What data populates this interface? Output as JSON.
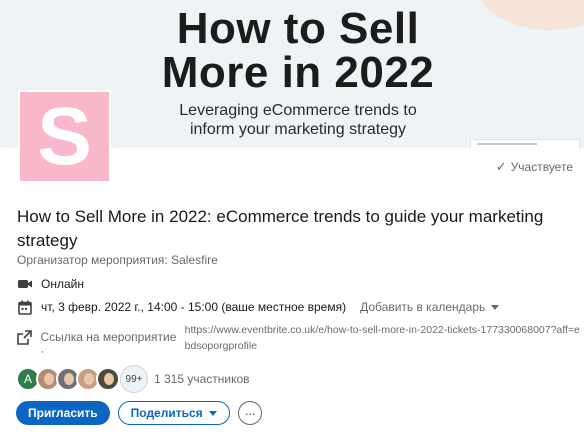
{
  "banner": {
    "title_line1": "How to Sell",
    "title_line2": "More in 2022",
    "subtitle_line1": "Leveraging eCommerce trends to",
    "subtitle_line2": "inform your marketing strategy"
  },
  "logo": {
    "letter": "S",
    "color": "#f9b8c9"
  },
  "status": {
    "attending_label": "Участвуете"
  },
  "event": {
    "title": "How to Sell More in 2022: eCommerce trends to guide your marketing strategy",
    "organizer_prefix": "Организатор мероприятия:",
    "organizer_name": "Salesfire",
    "format": "Онлайн",
    "datetime": "чт, 3 февр. 2022 г., 14:00 - 15:00 (ваше местное время)",
    "add_to_calendar": "Добавить в календарь",
    "link_label": "Ссылка на мероприятие ·",
    "link_url": "https://www.eventbrite.co.uk/e/how-to-sell-more-in-2022-tickets-177330068007?aff=ebdsoporgprofile"
  },
  "attendees": {
    "first_avatar_initial": "A",
    "more_badge": "99+",
    "count_text": "1 315 участников"
  },
  "actions": {
    "invite_label": "Пригласить",
    "share_label": "Поделиться",
    "more_label": "···"
  },
  "colors": {
    "accent": "#0a66c2",
    "banner_bg": "#eef3f6"
  }
}
